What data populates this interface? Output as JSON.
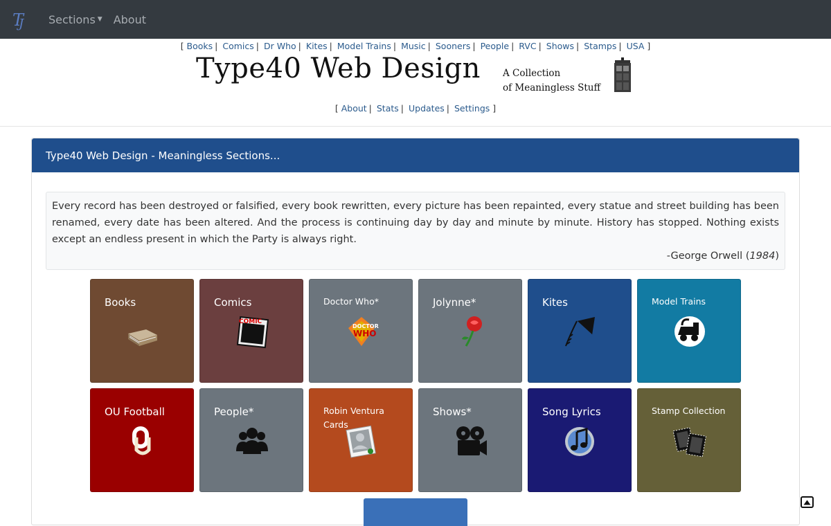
{
  "navbar": {
    "brand_icon": "type40-logo-icon",
    "sections_label": "Sections",
    "about_label": "About"
  },
  "toplinks": [
    "Books",
    "Comics",
    "Dr Who",
    "Kites",
    "Model Trains",
    "Music",
    "Sooners",
    "People",
    "RVC",
    "Shows",
    "Stamps",
    "USA"
  ],
  "logo": {
    "title": "Type40 Web Design",
    "tagline_1": "A Collection",
    "tagline_2": "of Meaningless Stuff"
  },
  "sublinks": [
    "About",
    "Stats",
    "Updates",
    "Settings"
  ],
  "card": {
    "title": "Type40 Web Design - Meaningless Sections..."
  },
  "quote": {
    "text": "Every record has been destroyed or falsified, every book rewritten, every picture has been repainted, every statue and street building has been renamed, every date has been altered. And the process is continuing day by day and minute by minute. History has stopped. Nothing exists except an endless present in which the Party is always right.",
    "author": "-George Orwell (",
    "book": "1984",
    "close": ")"
  },
  "tiles": [
    {
      "label": "Books",
      "color": "#6f4a32",
      "icon": "book-icon"
    },
    {
      "label": "Comics",
      "color": "#6b3f3f",
      "icon": "comic-icon"
    },
    {
      "label": "Doctor Who*",
      "color": "#6c757d",
      "icon": "doctor-who-logo-icon"
    },
    {
      "label": "Jolynne*",
      "color": "#6c757d",
      "icon": "rose-icon"
    },
    {
      "label": "Kites",
      "color": "#1f4e8c",
      "icon": "kite-icon"
    },
    {
      "label": "Model Trains",
      "color": "#127ba3",
      "icon": "train-icon"
    },
    {
      "label": "OU Football",
      "color": "#9a0000",
      "icon": "ou-logo-icon"
    },
    {
      "label": "People*",
      "color": "#6c757d",
      "icon": "people-icon"
    },
    {
      "label": "Robin Ventura Cards",
      "color": "#b44a1e",
      "icon": "card-icon"
    },
    {
      "label": "Shows*",
      "color": "#6c757d",
      "icon": "film-camera-icon"
    },
    {
      "label": "Song Lyrics",
      "color": "#1a1a73",
      "icon": "music-note-icon"
    },
    {
      "label": "Stamp Collection",
      "color": "#656038",
      "icon": "stamp-icon"
    }
  ]
}
